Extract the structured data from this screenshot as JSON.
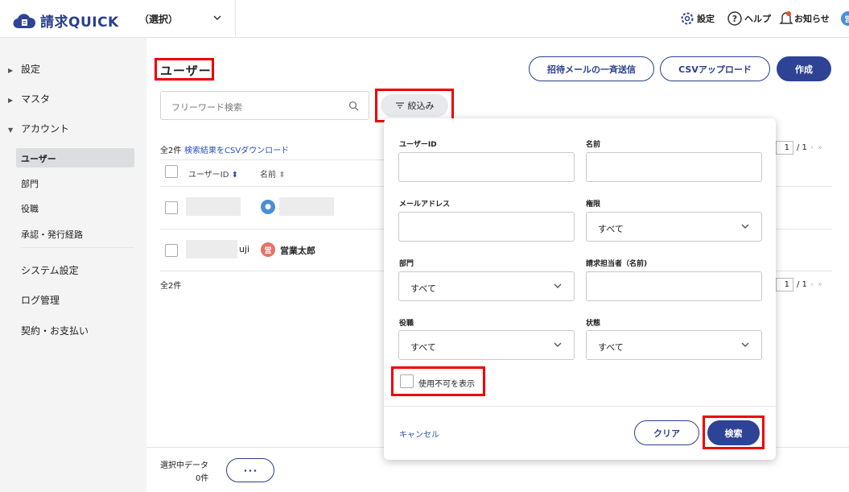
{
  "app": {
    "name": "請求QUICK",
    "tenant": "（選択）"
  },
  "topnav": {
    "settings": "設定",
    "help": "ヘルプ",
    "notice": "お知らせ"
  },
  "sidebar": {
    "items": [
      {
        "label": "設定"
      },
      {
        "label": "マスタ"
      },
      {
        "label": "アカウント"
      }
    ],
    "account_sub": [
      {
        "label": "ユーザー"
      },
      {
        "label": "部門"
      },
      {
        "label": "役職"
      },
      {
        "label": "承認・発行経路"
      }
    ],
    "bottom_items": [
      {
        "label": "システム設定"
      },
      {
        "label": "ログ管理"
      },
      {
        "label": "契約・お支払い"
      }
    ]
  },
  "page": {
    "title": "ユーザー",
    "btn_invite": "招待メールの一斉送信",
    "btn_csv": "CSVアップロード",
    "btn_create": "作成",
    "search_placeholder": "フリーワード検索",
    "filter_label": "絞込み",
    "count": "全2件",
    "count_bottom": "全2件",
    "download": "検索結果をCSVダウンロード",
    "col_userid": "ユーザーID",
    "col_name": "名前",
    "row2_id_suffix": "uji",
    "row2_name": "営業太郎",
    "row2_avatar": "営",
    "pager_page": "1",
    "pager_total": "/ 1"
  },
  "bottom": {
    "selected_label": "選択中データ",
    "selected_count": "0件",
    "more": "･･･"
  },
  "modal": {
    "userid_label": "ユーザーID",
    "name_label": "名前",
    "email_label": "メールアドレス",
    "perm_label": "権限",
    "perm_value": "すべて",
    "dept_label": "部門",
    "dept_value": "すべて",
    "billing_label": "請求担当者（名前)",
    "role_label": "役職",
    "role_value": "すべて",
    "status_label": "状態",
    "status_value": "すべて",
    "show_disabled": "使用不可を表示",
    "cancel": "キャンセル",
    "clear": "クリア",
    "search": "検索"
  },
  "colors": {
    "brand": "#2e4396",
    "highlight": "#e00000"
  }
}
